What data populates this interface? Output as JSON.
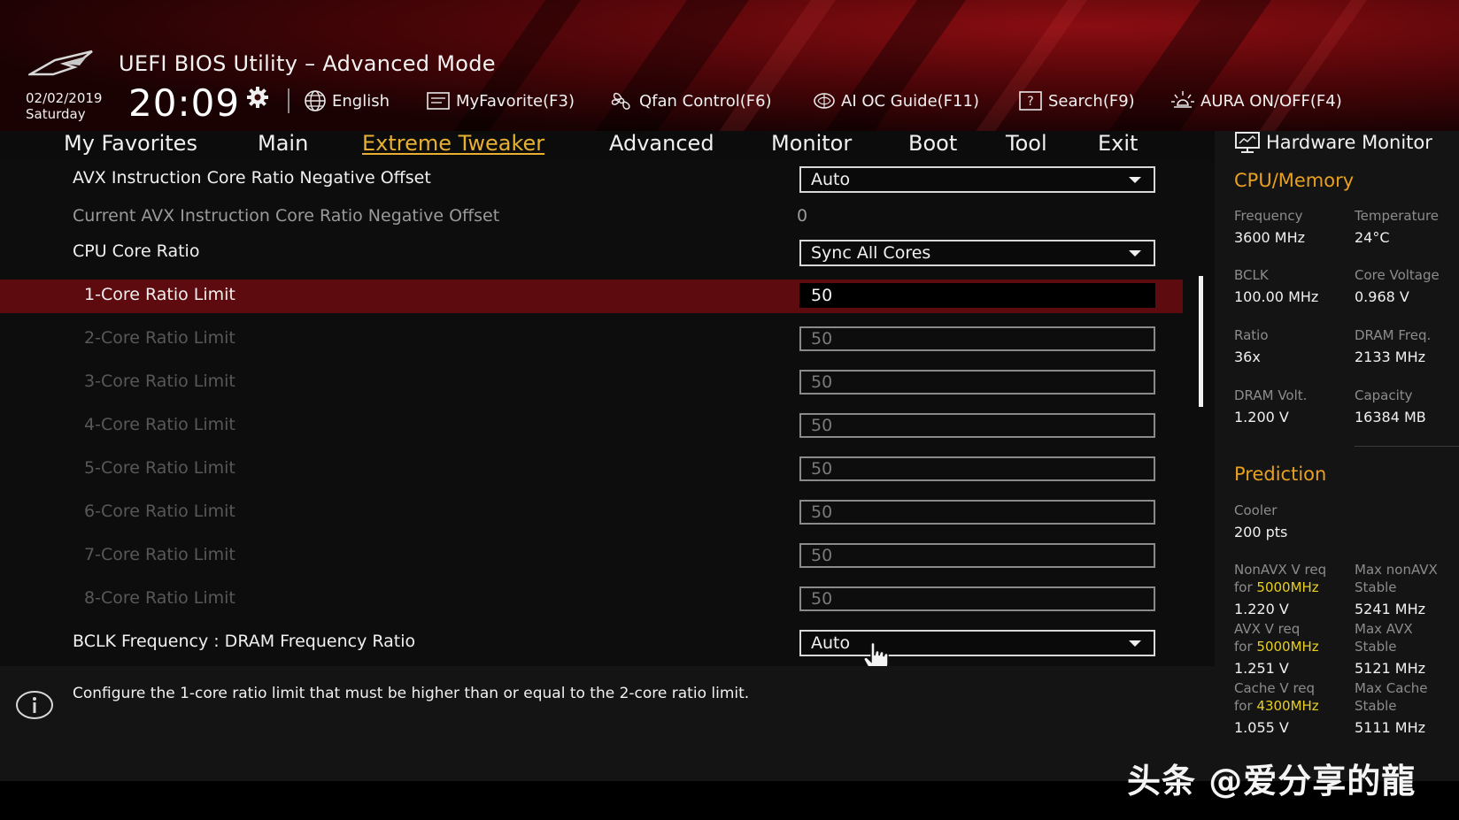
{
  "header": {
    "title": "UEFI BIOS Utility – Advanced Mode",
    "date": "02/02/2019",
    "weekday": "Saturday",
    "time": "20:09",
    "toolbar": {
      "language": "English",
      "my_favorite": "MyFavorite(F3)",
      "qfan": "Qfan Control(F6)",
      "ai_oc": "AI OC Guide(F11)",
      "search": "Search(F9)",
      "aura": "AURA ON/OFF(F4)"
    }
  },
  "nav": {
    "tabs": [
      "My Favorites",
      "Main",
      "Extreme Tweaker",
      "Advanced",
      "Monitor",
      "Boot",
      "Tool",
      "Exit"
    ],
    "active": "Extreme Tweaker"
  },
  "settings": {
    "avx_offset": {
      "label": "AVX Instruction Core Ratio Negative Offset",
      "value": "Auto"
    },
    "current_avx_offset": {
      "label": "Current AVX Instruction Core Ratio Negative Offset",
      "value": "0"
    },
    "cpu_core_ratio": {
      "label": "CPU Core Ratio",
      "value": "Sync All Cores"
    },
    "core_limits": [
      {
        "label": "1-Core Ratio Limit",
        "value": "50"
      },
      {
        "label": "2-Core Ratio Limit",
        "value": "50"
      },
      {
        "label": "3-Core Ratio Limit",
        "value": "50"
      },
      {
        "label": "4-Core Ratio Limit",
        "value": "50"
      },
      {
        "label": "5-Core Ratio Limit",
        "value": "50"
      },
      {
        "label": "6-Core Ratio Limit",
        "value": "50"
      },
      {
        "label": "7-Core Ratio Limit",
        "value": "50"
      },
      {
        "label": "8-Core Ratio Limit",
        "value": "50"
      }
    ],
    "bclk_dram_ratio": {
      "label": "BCLK Frequency : DRAM Frequency Ratio",
      "value": "Auto"
    }
  },
  "info": {
    "text": "Configure the 1-core ratio limit that must be higher than or equal to the 2-core ratio limit."
  },
  "hardware_monitor": {
    "title": "Hardware Monitor",
    "cpu_memory": {
      "heading": "CPU/Memory",
      "frequency_label": "Frequency",
      "frequency": "3600 MHz",
      "temperature_label": "Temperature",
      "temperature": "24°C",
      "bclk_label": "BCLK",
      "bclk": "100.00 MHz",
      "core_voltage_label": "Core Voltage",
      "core_voltage": "0.968 V",
      "ratio_label": "Ratio",
      "ratio": "36x",
      "dram_freq_label": "DRAM Freq.",
      "dram_freq": "2133 MHz",
      "dram_volt_label": "DRAM Volt.",
      "dram_volt": "1.200 V",
      "capacity_label": "Capacity",
      "capacity": "16384 MB"
    },
    "prediction": {
      "heading": "Prediction",
      "cooler_label": "Cooler",
      "cooler": "200 pts",
      "nonavx_req_label": "NonAVX V req",
      "for_label": "for",
      "nonavx_freq": "5000MHz",
      "nonavx_v": "1.220 V",
      "max_nonavx_label": "Max nonAVX",
      "stable_label": "Stable",
      "max_nonavx": "5241 MHz",
      "avx_req_label": "AVX V req",
      "avx_freq": "5000MHz",
      "avx_v": "1.251 V",
      "max_avx_label": "Max AVX",
      "max_avx": "5121 MHz",
      "cache_req_label": "Cache V req",
      "cache_freq": "4300MHz",
      "cache_v": "1.055 V",
      "max_cache_label": "Max Cache",
      "max_cache": "5111 MHz"
    }
  },
  "watermark": "头条 @爱分享的龍",
  "colors": {
    "accent": "#e8b030",
    "highlight_row": "#5e0b0f",
    "prediction_value": "#e8d020"
  }
}
